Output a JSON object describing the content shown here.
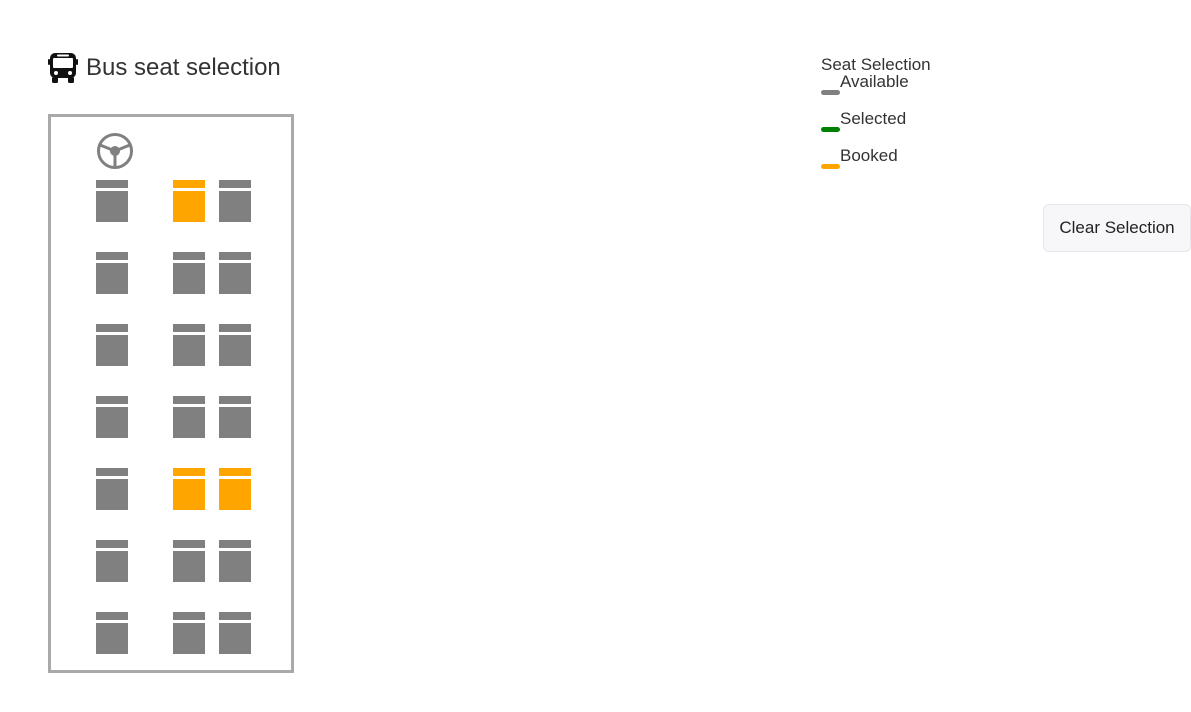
{
  "header": {
    "title": "Bus seat selection",
    "icon": "bus-icon"
  },
  "steering": {
    "icon": "steering-wheel-icon"
  },
  "colors": {
    "available": "#808080",
    "selected": "#008000",
    "booked": "#ffa500",
    "frame": "#a9a9a9"
  },
  "seat_columns": [
    "left",
    "aisle-left",
    "aisle-right"
  ],
  "seat_rows": [
    [
      "available",
      "booked",
      "available"
    ],
    [
      "available",
      "available",
      "available"
    ],
    [
      "available",
      "available",
      "available"
    ],
    [
      "available",
      "available",
      "available"
    ],
    [
      "available",
      "booked",
      "booked"
    ],
    [
      "available",
      "available",
      "available"
    ],
    [
      "available",
      "available",
      "available"
    ]
  ],
  "legend": {
    "title": "Seat Selection",
    "items": [
      {
        "status": "available",
        "label": "Available"
      },
      {
        "status": "selected",
        "label": "Selected"
      },
      {
        "status": "booked",
        "label": "Booked"
      }
    ]
  },
  "actions": {
    "clear_label": "Clear Selection"
  }
}
